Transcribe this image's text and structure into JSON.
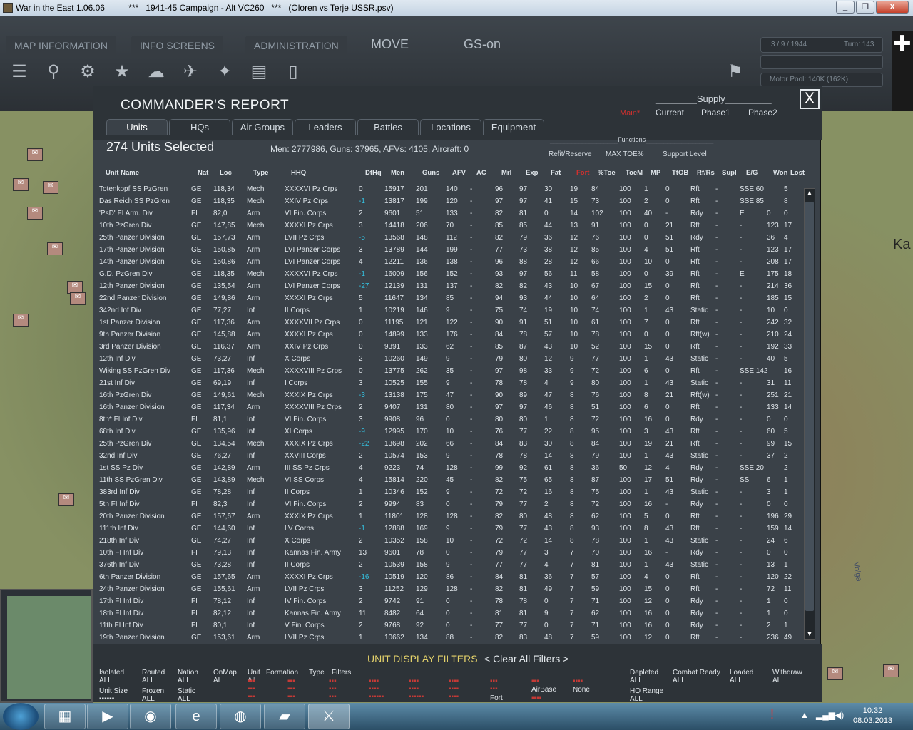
{
  "window": {
    "title": "War in the East 1.06.06          ***   1941-45 Campaign - Alt VC260   ***   (Oloren vs Terje USSR.psv)",
    "minimize": "_",
    "restore": "❐",
    "close": "X"
  },
  "topbar": {
    "menus": [
      "MAP INFORMATION",
      "INFO SCREENS",
      "ADMINISTRATION"
    ],
    "mode": "MOVE",
    "gs": "GS-on",
    "date": "3 / 9 / 1944",
    "turn": "Turn: 143",
    "motor_pool": "Motor Pool:  140K (162K)",
    "icons": [
      "menu-icon",
      "formation-icon",
      "gear-icon",
      "star-icon",
      "weather-icon",
      "air-icon",
      "supply-icon",
      "rail-icon",
      "clipboard-icon",
      "flag-icon"
    ]
  },
  "report": {
    "title": "COMMANDER'S REPORT",
    "close": "X",
    "supply_label": "________Supply_________",
    "supply_main": "Main*",
    "supply_cols": [
      "Current",
      "Phase1",
      "Phase2"
    ],
    "tabs": [
      "Units",
      "HQs",
      "Air Groups",
      "Leaders",
      "Battles",
      "Locations",
      "Equipment"
    ],
    "units_selected": "274 Units Selected",
    "stats": "Men: 2777986, Guns: 37965, AFVs: 4105, Aircraft: 0",
    "functions_label": "___________________Functions___________________",
    "functions": [
      "Refit/Reserve",
      "MAX TOE%",
      "Support Level"
    ],
    "columns": [
      "Unit Name",
      "Nat",
      "Loc",
      "Type",
      "HHQ",
      "DtHq",
      "Men",
      "Guns",
      "AFV",
      "AC",
      "Mrl",
      "Exp",
      "Fat",
      "Fort",
      "%Toe",
      "ToeM",
      "MP",
      "TtOB",
      "Rf/Rs",
      "Supl",
      "E/G",
      "Won",
      "Lost"
    ],
    "rows": [
      [
        "Totenkopf SS PzGren",
        "GE",
        "118,34",
        "Mech",
        "XXXXVI Pz Crps",
        "0",
        "15917",
        "201",
        "140",
        "-",
        "96",
        "97",
        "30",
        "19",
        "84",
        "100",
        "1",
        "0",
        "Rft",
        "-",
        "SSE 60",
        "",
        "5"
      ],
      [
        "Das Reich SS PzGren",
        "GE",
        "118,35",
        "Mech",
        "XXIV Pz Crps",
        "-1",
        "13817",
        "199",
        "120",
        "-",
        "97",
        "97",
        "41",
        "15",
        "73",
        "100",
        "2",
        "0",
        "Rft",
        "-",
        "SSE 85",
        "",
        "8"
      ],
      [
        "'PsD' FI Arm. Div",
        "FI",
        "82,0",
        "Arm",
        "VI Fin. Corps",
        "2",
        "9601",
        "51",
        "133",
        "-",
        "82",
        "81",
        "0",
        "14",
        "102",
        "100",
        "40",
        "-",
        "Rdy",
        "-",
        "E",
        "0",
        "0"
      ],
      [
        "10th PzGren Div",
        "GE",
        "147,85",
        "Mech",
        "XXXXI Pz Crps",
        "3",
        "14418",
        "206",
        "70",
        "-",
        "85",
        "85",
        "44",
        "13",
        "91",
        "100",
        "0",
        "21",
        "Rft",
        "-",
        "-",
        "123",
        "17"
      ],
      [
        "25th Panzer Division",
        "GE",
        "157,73",
        "Arm",
        "LVII Pz Crps",
        "-5",
        "13568",
        "148",
        "112",
        "-",
        "82",
        "79",
        "36",
        "12",
        "76",
        "100",
        "0",
        "51",
        "Rdy",
        "-",
        "-",
        "36",
        "4"
      ],
      [
        "17th Panzer Division",
        "GE",
        "150,85",
        "Arm",
        "LVI Panzer Corps",
        "3",
        "13789",
        "144",
        "199",
        "-",
        "77",
        "73",
        "38",
        "12",
        "85",
        "100",
        "4",
        "51",
        "Rft",
        "-",
        "-",
        "123",
        "17"
      ],
      [
        "14th Panzer Division",
        "GE",
        "150,86",
        "Arm",
        "LVI Panzer Corps",
        "4",
        "12211",
        "136",
        "138",
        "-",
        "96",
        "88",
        "28",
        "12",
        "66",
        "100",
        "10",
        "0",
        "Rft",
        "-",
        "-",
        "208",
        "17"
      ],
      [
        "G.D. PzGren Div",
        "GE",
        "118,35",
        "Mech",
        "XXXXVI Pz Crps",
        "-1",
        "16009",
        "156",
        "152",
        "-",
        "93",
        "97",
        "56",
        "11",
        "58",
        "100",
        "0",
        "39",
        "Rft",
        "-",
        "E",
        "175",
        "18"
      ],
      [
        "12th Panzer Division",
        "GE",
        "135,54",
        "Arm",
        "LVI Panzer Corps",
        "-27",
        "12139",
        "131",
        "137",
        "-",
        "82",
        "82",
        "43",
        "10",
        "67",
        "100",
        "15",
        "0",
        "Rft",
        "-",
        "-",
        "214",
        "36"
      ],
      [
        "22nd Panzer Division",
        "GE",
        "149,86",
        "Arm",
        "XXXXI Pz Crps",
        "5",
        "11647",
        "134",
        "85",
        "-",
        "94",
        "93",
        "44",
        "10",
        "64",
        "100",
        "2",
        "0",
        "Rft",
        "-",
        "-",
        "185",
        "15"
      ],
      [
        "342nd Inf Div",
        "GE",
        "77,27",
        "Inf",
        "II Corps",
        "1",
        "10219",
        "146",
        "9",
        "-",
        "75",
        "74",
        "19",
        "10",
        "74",
        "100",
        "1",
        "43",
        "Static",
        "-",
        "-",
        "10",
        "0"
      ],
      [
        "1st Panzer Division",
        "GE",
        "117,36",
        "Arm",
        "XXXXVII Pz Crps",
        "0",
        "11195",
        "121",
        "122",
        "-",
        "90",
        "91",
        "51",
        "10",
        "61",
        "100",
        "7",
        "0",
        "Rft",
        "-",
        "-",
        "242",
        "32"
      ],
      [
        "9th Panzer Division",
        "GE",
        "145,88",
        "Arm",
        "XXXXI Pz Crps",
        "0",
        "14899",
        "133",
        "176",
        "-",
        "84",
        "78",
        "57",
        "10",
        "78",
        "100",
        "0",
        "0",
        "Rft(w)",
        "-",
        "-",
        "210",
        "24"
      ],
      [
        "3rd Panzer Division",
        "GE",
        "116,37",
        "Arm",
        "XXIV Pz Crps",
        "0",
        "9391",
        "133",
        "62",
        "-",
        "85",
        "87",
        "43",
        "10",
        "52",
        "100",
        "15",
        "0",
        "Rft",
        "-",
        "-",
        "192",
        "33"
      ],
      [
        "12th Inf Div",
        "GE",
        "73,27",
        "Inf",
        "X Corps",
        "2",
        "10260",
        "149",
        "9",
        "-",
        "79",
        "80",
        "12",
        "9",
        "77",
        "100",
        "1",
        "43",
        "Static",
        "-",
        "-",
        "40",
        "5"
      ],
      [
        "Wiking SS PzGren Div",
        "GE",
        "117,36",
        "Mech",
        "XXXXVIII Pz Crps",
        "0",
        "13775",
        "262",
        "35",
        "-",
        "97",
        "98",
        "33",
        "9",
        "72",
        "100",
        "6",
        "0",
        "Rft",
        "-",
        "SSE 142",
        "",
        "16"
      ],
      [
        "21st Inf Div",
        "GE",
        "69,19",
        "Inf",
        "I Corps",
        "3",
        "10525",
        "155",
        "9",
        "-",
        "78",
        "78",
        "4",
        "9",
        "80",
        "100",
        "1",
        "43",
        "Static",
        "-",
        "-",
        "31",
        "11"
      ],
      [
        "16th PzGren Div",
        "GE",
        "149,61",
        "Mech",
        "XXXIX Pz Crps",
        "-3",
        "13138",
        "175",
        "47",
        "-",
        "90",
        "89",
        "47",
        "8",
        "76",
        "100",
        "8",
        "21",
        "Rft(w)",
        "-",
        "-",
        "251",
        "21"
      ],
      [
        "16th Panzer Division",
        "GE",
        "117,34",
        "Arm",
        "XXXXVIII Pz Crps",
        "2",
        "9407",
        "131",
        "80",
        "-",
        "97",
        "97",
        "46",
        "8",
        "51",
        "100",
        "6",
        "0",
        "Rft",
        "-",
        "-",
        "133",
        "14"
      ],
      [
        "8th* FI Inf Div",
        "FI",
        "81,1",
        "Inf",
        "VI Fin. Corps",
        "3",
        "9908",
        "96",
        "0",
        "-",
        "80",
        "80",
        "1",
        "8",
        "72",
        "100",
        "16",
        "0",
        "Rdy",
        "-",
        "-",
        "0",
        "0"
      ],
      [
        "68th Inf Div",
        "GE",
        "135,96",
        "Inf",
        "XI Corps",
        "-9",
        "12995",
        "170",
        "10",
        "-",
        "76",
        "77",
        "22",
        "8",
        "95",
        "100",
        "3",
        "43",
        "Rft",
        "-",
        "-",
        "60",
        "5"
      ],
      [
        "25th PzGren Div",
        "GE",
        "134,54",
        "Mech",
        "XXXIX Pz Crps",
        "-22",
        "13698",
        "202",
        "66",
        "-",
        "84",
        "83",
        "30",
        "8",
        "84",
        "100",
        "19",
        "21",
        "Rft",
        "-",
        "-",
        "99",
        "15"
      ],
      [
        "32nd Inf Div",
        "GE",
        "76,27",
        "Inf",
        "XXVIII Corps",
        "2",
        "10574",
        "153",
        "9",
        "-",
        "78",
        "78",
        "14",
        "8",
        "79",
        "100",
        "1",
        "43",
        "Static",
        "-",
        "-",
        "37",
        "2"
      ],
      [
        "1st SS Pz Div",
        "GE",
        "142,89",
        "Arm",
        "III SS Pz Crps",
        "4",
        "9223",
        "74",
        "128",
        "-",
        "99",
        "92",
        "61",
        "8",
        "36",
        "50",
        "12",
        "4",
        "Rdy",
        "-",
        "SSE 20",
        "",
        "2"
      ],
      [
        "11th SS PzGren Div",
        "GE",
        "143,89",
        "Mech",
        "VI SS Corps",
        "4",
        "15814",
        "220",
        "45",
        "-",
        "82",
        "75",
        "65",
        "8",
        "87",
        "100",
        "17",
        "51",
        "Rdy",
        "-",
        "SS",
        "6",
        "1"
      ],
      [
        "383rd Inf Div",
        "GE",
        "78,28",
        "Inf",
        "II Corps",
        "1",
        "10346",
        "152",
        "9",
        "-",
        "72",
        "72",
        "16",
        "8",
        "75",
        "100",
        "1",
        "43",
        "Static",
        "-",
        "-",
        "3",
        "1"
      ],
      [
        "5th FI Inf Div",
        "FI",
        "82,3",
        "Inf",
        "VI Fin. Corps",
        "2",
        "9994",
        "83",
        "0",
        "-",
        "79",
        "77",
        "2",
        "8",
        "72",
        "100",
        "16",
        "-",
        "Rdy",
        "-",
        "-",
        "0",
        "0"
      ],
      [
        "20th Panzer Division",
        "GE",
        "157,67",
        "Arm",
        "XXXIX Pz Crps",
        "1",
        "11801",
        "128",
        "128",
        "-",
        "82",
        "80",
        "48",
        "8",
        "62",
        "100",
        "5",
        "0",
        "Rft",
        "-",
        "-",
        "196",
        "29"
      ],
      [
        "111th Inf Div",
        "GE",
        "144,60",
        "Inf",
        "LV Corps",
        "-1",
        "12888",
        "169",
        "9",
        "-",
        "79",
        "77",
        "43",
        "8",
        "93",
        "100",
        "8",
        "43",
        "Rft",
        "-",
        "-",
        "159",
        "14"
      ],
      [
        "218th Inf Div",
        "GE",
        "74,27",
        "Inf",
        "X Corps",
        "2",
        "10352",
        "158",
        "10",
        "-",
        "72",
        "72",
        "14",
        "8",
        "78",
        "100",
        "1",
        "43",
        "Static",
        "-",
        "-",
        "24",
        "6"
      ],
      [
        "10th FI Inf Div",
        "FI",
        "79,13",
        "Inf",
        "Kannas Fin. Army",
        "13",
        "9601",
        "78",
        "0",
        "-",
        "79",
        "77",
        "3",
        "7",
        "70",
        "100",
        "16",
        "-",
        "Rdy",
        "-",
        "-",
        "0",
        "0"
      ],
      [
        "376th Inf Div",
        "GE",
        "73,28",
        "Inf",
        "II Corps",
        "2",
        "10539",
        "158",
        "9",
        "-",
        "77",
        "77",
        "4",
        "7",
        "81",
        "100",
        "1",
        "43",
        "Static",
        "-",
        "-",
        "13",
        "1"
      ],
      [
        "6th Panzer Division",
        "GE",
        "157,65",
        "Arm",
        "XXXXI Pz Crps",
        "-16",
        "10519",
        "120",
        "86",
        "-",
        "84",
        "81",
        "36",
        "7",
        "57",
        "100",
        "4",
        "0",
        "Rft",
        "-",
        "-",
        "120",
        "22"
      ],
      [
        "24th Panzer Division",
        "GE",
        "155,61",
        "Arm",
        "LVII Pz Crps",
        "3",
        "11252",
        "129",
        "128",
        "-",
        "82",
        "81",
        "49",
        "7",
        "59",
        "100",
        "15",
        "0",
        "Rft",
        "-",
        "-",
        "72",
        "11"
      ],
      [
        "17th FI Inf Div",
        "FI",
        "78,12",
        "Inf",
        "IV Fin. Corps",
        "2",
        "9742",
        "91",
        "0",
        "-",
        "78",
        "78",
        "0",
        "7",
        "71",
        "100",
        "12",
        "0",
        "Rdy",
        "-",
        "-",
        "1",
        "0"
      ],
      [
        "18th FI Inf Div",
        "FI",
        "82,12",
        "Inf",
        "Kannas Fin. Army",
        "11",
        "8482",
        "64",
        "0",
        "-",
        "81",
        "81",
        "9",
        "7",
        "62",
        "100",
        "16",
        "0",
        "Rdy",
        "-",
        "-",
        "1",
        "0"
      ],
      [
        "11th FI Inf Div",
        "FI",
        "80,1",
        "Inf",
        "V Fin. Corps",
        "2",
        "9768",
        "92",
        "0",
        "-",
        "77",
        "77",
        "0",
        "7",
        "71",
        "100",
        "16",
        "0",
        "Rdy",
        "-",
        "-",
        "2",
        "1"
      ],
      [
        "19th Panzer Division",
        "GE",
        "153,61",
        "Arm",
        "LVII Pz Crps",
        "1",
        "10662",
        "134",
        "88",
        "-",
        "82",
        "83",
        "48",
        "7",
        "59",
        "100",
        "12",
        "0",
        "Rft",
        "-",
        "-",
        "236",
        "49"
      ]
    ]
  },
  "filters": {
    "title": "UNIT DISPLAY FILTERS",
    "clear": "< Clear All Filters >",
    "groups": [
      {
        "label": "Isolated",
        "value": "ALL"
      },
      {
        "label": "Routed",
        "value": "ALL"
      },
      {
        "label": "Nation",
        "value": "ALL"
      },
      {
        "label": "OnMap",
        "value": "ALL"
      },
      {
        "label": "Unit",
        "value": "All"
      },
      {
        "label": "Formation",
        "value": ""
      },
      {
        "label": "Type",
        "value": ""
      },
      {
        "label": "Filters",
        "value": ""
      },
      {
        "label": "Depleted",
        "value": "ALL"
      },
      {
        "label": "Combat Ready",
        "value": "ALL"
      },
      {
        "label": "Loaded",
        "value": "ALL"
      },
      {
        "label": "Withdraw",
        "value": "ALL"
      },
      {
        "label": "Unit Size",
        "value": ""
      },
      {
        "label": "Frozen",
        "value": "ALL"
      },
      {
        "label": "Static",
        "value": "ALL"
      },
      {
        "label": "HQ Range",
        "value": "ALL"
      }
    ],
    "fort": "Fort",
    "airbase": "AirBase",
    "none": "None"
  },
  "map": {
    "volga": "Volga",
    "ka": "Ka"
  },
  "taskbar": {
    "time": "10:32",
    "date": "08.03.2013"
  }
}
